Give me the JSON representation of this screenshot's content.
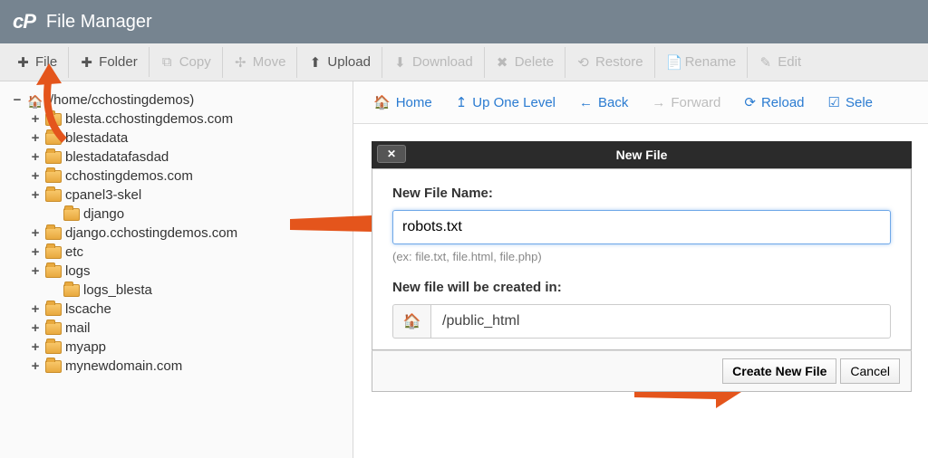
{
  "header": {
    "title": "File Manager"
  },
  "toolbar": {
    "file": "File",
    "folder": "Folder",
    "copy": "Copy",
    "move": "Move",
    "upload": "Upload",
    "download": "Download",
    "delete": "Delete",
    "restore": "Restore",
    "rename": "Rename",
    "edit": "Edit"
  },
  "tree": {
    "root_toggle": "−",
    "root_label": "(/home/cchostingdemos)",
    "items": [
      {
        "toggle": "+",
        "label": "blesta.cchostingdemos.com",
        "indent": 1
      },
      {
        "toggle": "+",
        "label": "blestadata",
        "indent": 1
      },
      {
        "toggle": "+",
        "label": "blestadatafasdad",
        "indent": 1
      },
      {
        "toggle": "+",
        "label": "cchostingdemos.com",
        "indent": 1
      },
      {
        "toggle": "+",
        "label": "cpanel3-skel",
        "indent": 1
      },
      {
        "toggle": "",
        "label": "django",
        "indent": 2
      },
      {
        "toggle": "+",
        "label": "django.cchostingdemos.com",
        "indent": 1
      },
      {
        "toggle": "+",
        "label": "etc",
        "indent": 1
      },
      {
        "toggle": "+",
        "label": "logs",
        "indent": 1
      },
      {
        "toggle": "",
        "label": "logs_blesta",
        "indent": 2
      },
      {
        "toggle": "+",
        "label": "lscache",
        "indent": 1
      },
      {
        "toggle": "+",
        "label": "mail",
        "indent": 1
      },
      {
        "toggle": "+",
        "label": "myapp",
        "indent": 1
      },
      {
        "toggle": "+",
        "label": "mynewdomain.com",
        "indent": 1
      }
    ]
  },
  "nav": {
    "home": "Home",
    "up": "Up One Level",
    "back": "Back",
    "forward": "Forward",
    "reload": "Reload",
    "select_all": "Sele"
  },
  "dialog": {
    "title": "New File",
    "name_label": "New File Name:",
    "name_value": "robots.txt",
    "hint": "(ex: file.txt, file.html, file.php)",
    "path_label": "New file will be created in:",
    "path_value": "/public_html",
    "create_btn": "Create New File",
    "cancel_btn": "Cancel"
  }
}
